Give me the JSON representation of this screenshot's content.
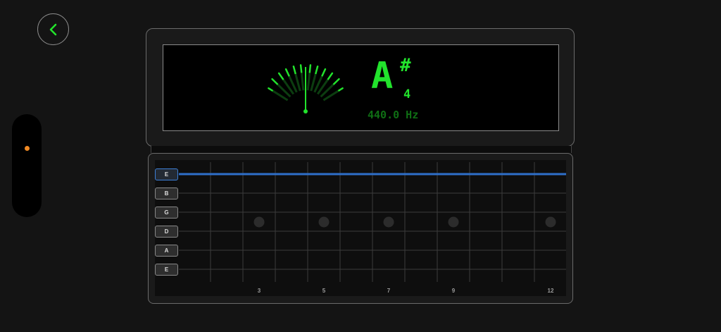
{
  "nav": {
    "back_icon": "chevron-left-icon"
  },
  "side_indicator": {
    "dot_color": "#f08a24"
  },
  "tuner": {
    "note": "A",
    "accidental": "#",
    "octave": "4",
    "frequency": "440.0 Hz",
    "needle_position": "center",
    "display_color": "#22e32c"
  },
  "fretboard": {
    "strings": [
      {
        "label": "E",
        "selected": true
      },
      {
        "label": "B",
        "selected": false
      },
      {
        "label": "G",
        "selected": false
      },
      {
        "label": "D",
        "selected": false
      },
      {
        "label": "A",
        "selected": false
      },
      {
        "label": "E",
        "selected": false
      }
    ],
    "fret_markers": [
      "3",
      "5",
      "7",
      "9",
      "12"
    ],
    "selected_string_color": "#2f6fc9"
  }
}
